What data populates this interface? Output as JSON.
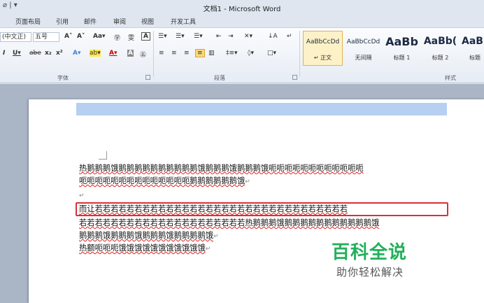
{
  "window": {
    "title": "文档1 - Microsoft Word",
    "qat": "⌀ | ▾"
  },
  "tabs": [
    "页面布局",
    "引用",
    "邮件",
    "审阅",
    "视图",
    "开发工具"
  ],
  "ribbon": {
    "font_name": "(中文正)",
    "font_size": "五号",
    "font_row1": [
      "A˄",
      "A˅",
      "Aa▾",
      "㊫",
      "雯",
      "A"
    ],
    "font_row2": [
      "I",
      "U▾",
      "abe",
      "x₂",
      "x²",
      "A▾",
      "ab▾",
      "A▾",
      "A",
      "㊄"
    ],
    "para_row1": [
      "☰▾",
      "☰▾",
      "☰▾",
      "⇤",
      "⇥",
      "✕▾",
      "↓A",
      "↵"
    ],
    "para_row2": [
      "≡",
      "≡",
      "≡",
      "≡",
      "▥",
      "‡≡▾",
      "◊▾",
      "□▾"
    ],
    "group_font": "字体",
    "group_paragraph": "段落",
    "group_styles": "样式",
    "styles": [
      {
        "preview": "AaBbCcDd",
        "name": "↵ 正文"
      },
      {
        "preview": "AaBbCcDd",
        "name": "无间隔"
      },
      {
        "preview": "AaBb",
        "name": "标题 1"
      },
      {
        "preview": "AaBb(",
        "name": "标题 2"
      },
      {
        "preview": "AaB",
        "name": "标题"
      }
    ]
  },
  "document": {
    "line1": "热鹅鹅鹅饿鹅鹅鹅鹅鹅鹅鹅鹅鹅鹅饿鹅鹅鹅饿鹅鹅鹅饿呃呃呃呃呃呃呃呃呃呃呃呃",
    "line2": "呃呃呃呃呃呃呃呃呃呃呃呃呃呃鹅鹅鹅鹅鹅鹅饿",
    "line3": "",
    "line4": "而让若若若若若若若若若若若若若若若若若若若若若若若若若若若若若若若若",
    "line5": "若若若若若若若若若若若若若若若若若若若若若热鹅鹅鹅饿鹅鹅鹅鹅鹅鹅鹅鹅鹅鹅鹅饿",
    "line6": "鹅鹅鹅饿鹅鹅鹅饿鹅鹅鹅饿鹅鹅鹅鹅饿",
    "line7": "热额呃呃呃饿饿饿饿饿饿饿饿饿饿饿"
  },
  "watermark": {
    "title": "百科全说",
    "subtitle": "助你轻松解决"
  },
  "colors": {
    "highlight": "#d9303a",
    "watermark": "#22b05a",
    "selection": "#b7cff0"
  }
}
